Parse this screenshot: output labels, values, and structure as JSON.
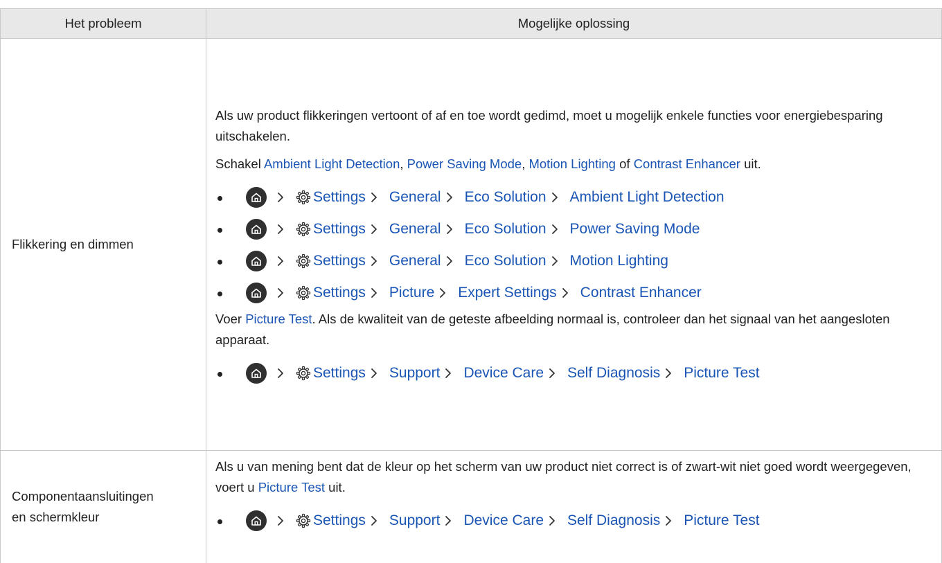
{
  "table": {
    "headers": [
      "Het probleem",
      "Mogelijke oplossing"
    ]
  },
  "rows": [
    {
      "problem": "Flikkering en dimmen",
      "intro": {
        "p1": "Als uw product flikkeringen vertoont of af en toe wordt gedimd, moet u mogelijk enkele functies voor energiebesparing uitschakelen.",
        "p2_pre": "Schakel ",
        "p2_l1": "Ambient Light Detection",
        "p2_s1": ", ",
        "p2_l2": "Power Saving Mode",
        "p2_s2": ", ",
        "p2_l3": "Motion Lighting",
        "p2_s3": " of ",
        "p2_l4": "Contrast Enhancer",
        "p2_post": " uit."
      },
      "paths": [
        [
          "Settings",
          "General",
          "Eco Solution",
          "Ambient Light Detection"
        ],
        [
          "Settings",
          "General",
          "Eco Solution",
          "Power Saving Mode"
        ],
        [
          "Settings",
          "General",
          "Eco Solution",
          "Motion Lighting"
        ],
        [
          "Settings",
          "Picture",
          "Expert Settings",
          "Contrast Enhancer"
        ]
      ],
      "after": {
        "pre": "Voer ",
        "link": "Picture Test",
        "post": ". Als de kwaliteit van de geteste afbeelding normaal is, controleer dan het signaal van het aangesloten apparaat."
      },
      "path_final": [
        "Settings",
        "Support",
        "Device Care",
        "Self Diagnosis",
        "Picture Test"
      ]
    },
    {
      "problem_line1": "Componentaansluitingen",
      "problem_line2": "en schermkleur",
      "intro": {
        "pre": "Als u van mening bent dat de kleur op het scherm van uw product niet correct is of zwart-wit niet goed wordt weergegeven, voert u ",
        "link": "Picture Test",
        "post": " uit."
      },
      "path": [
        "Settings",
        "Support",
        "Device Care",
        "Self Diagnosis",
        "Picture Test"
      ]
    }
  ],
  "icons": {
    "home": "home-icon",
    "settings": "gear-icon",
    "separator": "chevron-right-icon",
    "bullet": "bullet"
  },
  "colors": {
    "link": "#1a55b4",
    "header_bg": "#e8e8e8",
    "border": "#c8c8c8"
  }
}
